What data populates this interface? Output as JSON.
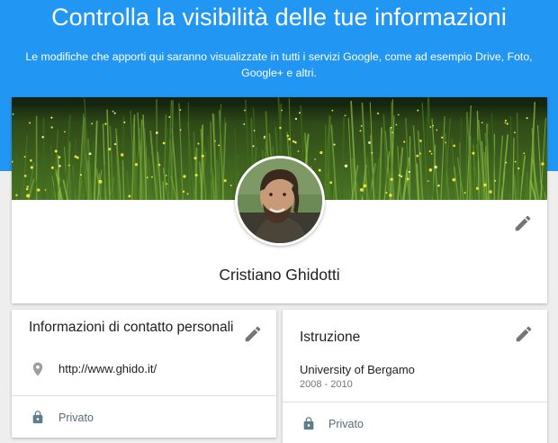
{
  "header": {
    "title": "Controlla la visibilità delle tue informazioni",
    "description": "Le modifiche che apporti qui saranno visualizzate in tutti i servizi Google, come ad esempio Drive, Foto, Google+ e altri."
  },
  "profile": {
    "name": "Cristiano Ghidotti",
    "cover_image": "meadow-grass-photo",
    "avatar_image": "profile-photo"
  },
  "contact_card": {
    "title": "Informazioni di contatto personali",
    "website": "http://www.ghido.it/",
    "visibility": "Privato"
  },
  "education_card": {
    "title": "Istruzione",
    "school": "University of Bergamo",
    "years": "2008 - 2010",
    "visibility": "Privato"
  },
  "colors": {
    "header_bg": "#2196f3",
    "page_bg": "#eeeeee",
    "icon_gray": "#757575",
    "privacy_text": "#546e7a"
  },
  "icons": {
    "edit": "pencil-icon",
    "location": "location-pin-icon",
    "lock": "lock-icon"
  }
}
